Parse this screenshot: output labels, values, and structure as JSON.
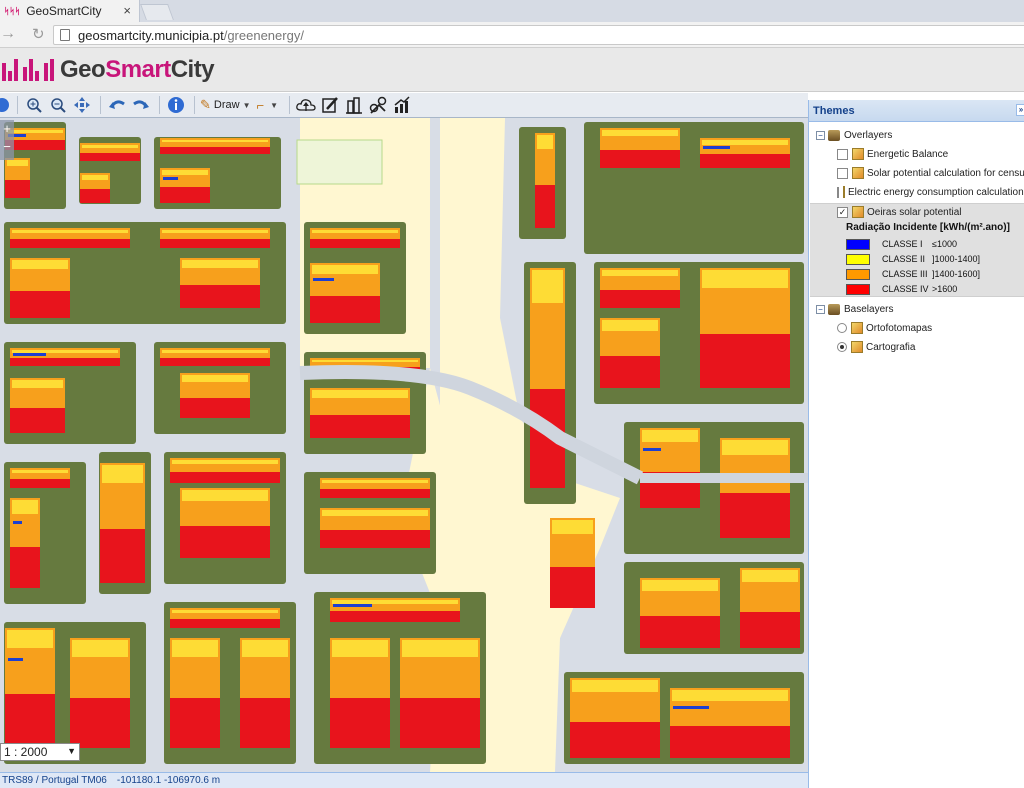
{
  "browser": {
    "tab_title": "GeoSmartCity",
    "favicon_text": "ᛋᛋᛋ",
    "tab_close": "×",
    "url_host": "geosmartcity.municipia.pt",
    "url_path": "/greenenergy/"
  },
  "header": {
    "logo_part1": "Geo",
    "logo_part2": "Smart",
    "logo_part3": "City",
    "brand_color": "#c8157a"
  },
  "toolbar": {
    "draw_label": "Draw",
    "icons": [
      "globe-icon",
      "zoom-in-icon",
      "zoom-out-icon",
      "pan-icon",
      "undo-icon",
      "redo-icon",
      "info-icon",
      "draw-icon",
      "measure-icon",
      "upload-icon",
      "edit-icon",
      "buildings-icon",
      "route-icon",
      "chart-icon"
    ]
  },
  "map": {
    "zoom_in": "+",
    "zoom_out": "−",
    "scale_value": "1 : 2000",
    "colors": {
      "road": "#d8dde6",
      "block": "#667a3f",
      "ground": "#fff7d1",
      "building_base": "#f7a01c",
      "class_iv": "#e8141c"
    }
  },
  "status": {
    "projection": "TRS89 / Portugal TM06",
    "coords": "-101180.1 -106970.6 m"
  },
  "themes": {
    "title": "Themes",
    "collapse_label": "»",
    "overlayers_label": "Overlayers",
    "overlayers": [
      {
        "label": "Energetic Balance",
        "checked": false
      },
      {
        "label": "Solar potential calculation for census tracts",
        "checked": false
      },
      {
        "label": "Electric energy consumption calculation for c",
        "checked": false
      },
      {
        "label": "Oeiras solar potential",
        "checked": true
      }
    ],
    "legend": {
      "title": "Radiação Incidente [kWh/(m².ano)]",
      "classes": [
        {
          "name": "CLASSE I",
          "range": "≤1000",
          "color": "#0000ff"
        },
        {
          "name": "CLASSE II",
          "range": "]1000-1400]",
          "color": "#ffff00"
        },
        {
          "name": "CLASSE III",
          "range": "]1400-1600]",
          "color": "#ff9900"
        },
        {
          "name": "CLASSE IV",
          "range": ">1600",
          "color": "#ff0000"
        }
      ]
    },
    "baselayers_label": "Baselayers",
    "baselayers": [
      {
        "label": "Ortofotomapas",
        "selected": false
      },
      {
        "label": "Cartografia",
        "selected": true
      }
    ],
    "check_mark": "✓"
  }
}
